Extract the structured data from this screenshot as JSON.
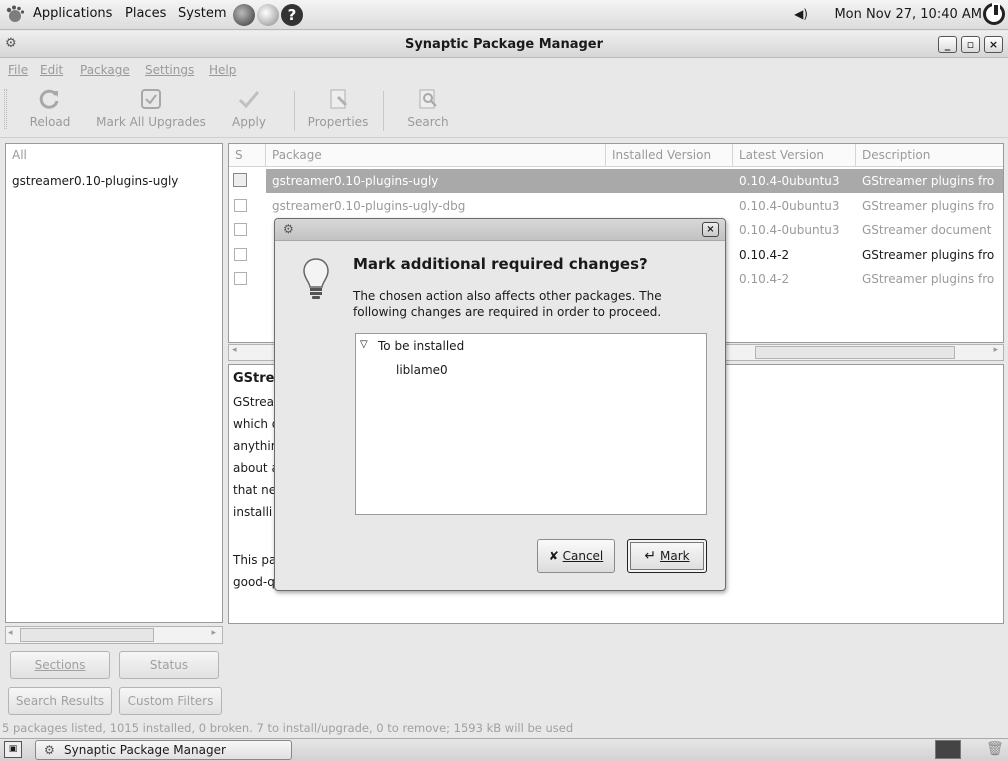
{
  "top_panel": {
    "menus": [
      "Applications",
      "Places",
      "System"
    ],
    "clock": "Mon Nov 27, 10:40 AM"
  },
  "window": {
    "title": "Synaptic Package Manager",
    "controls": {
      "minimize": "_",
      "maximize": "▫",
      "close": "×"
    }
  },
  "menubar": {
    "items": [
      "File",
      "Edit",
      "Package",
      "Settings",
      "Help"
    ]
  },
  "toolbar": {
    "reload": "Reload",
    "mark_all": "Mark All Upgrades",
    "apply": "Apply",
    "properties": "Properties",
    "search": "Search"
  },
  "filters": {
    "items": [
      "All",
      "gstreamer0.10-plugins-ugly"
    ],
    "buttons": {
      "sections": "Sections",
      "status": "Status",
      "search_results": "Search Results",
      "custom_filters": "Custom Filters"
    }
  },
  "package_list": {
    "columns": {
      "s": "S",
      "package": "Package",
      "installed": "Installed Version",
      "latest": "Latest Version",
      "description": "Description"
    },
    "rows": [
      {
        "package": "gstreamer0.10-plugins-ugly",
        "installed": "",
        "latest": "0.10.4-0ubuntu3",
        "description": "GStreamer plugins fro"
      },
      {
        "package": "gstreamer0.10-plugins-ugly-dbg",
        "installed": "",
        "latest": "0.10.4-0ubuntu3",
        "description": "GStreamer plugins fro"
      },
      {
        "package": "",
        "installed": "",
        "latest": "0.10.4-0ubuntu3",
        "description": "GStreamer document"
      },
      {
        "package": "",
        "installed": "",
        "latest": "0.10.4-2",
        "description": "GStreamer plugins fro"
      },
      {
        "package": "",
        "installed": "",
        "latest": "0.10.4-2",
        "description": "GStreamer plugins fro"
      }
    ]
  },
  "description": {
    "title": "GStre",
    "lines": [
      "GStrea",
      "which d",
      "anythin",
      "about a",
      "that ne",
      "installi",
      "",
      "This pa",
      "good-q"
    ]
  },
  "statusbar": {
    "text": "5 packages listed, 1015 installed, 0 broken. 7 to install/upgrade, 0 to remove; 1593 kB will be used"
  },
  "taskbar": {
    "window_button": "Synaptic Package Manager"
  },
  "dialog": {
    "heading": "Mark additional required changes?",
    "message": "The chosen action also affects other packages. The following changes are required in order to proceed.",
    "group_label": "To be installed",
    "packages": [
      "liblame0"
    ],
    "cancel": "Cancel",
    "mark": "Mark"
  },
  "colors": {
    "selection": "#aaaaaa",
    "disabled_text": "#9a9a9a"
  }
}
